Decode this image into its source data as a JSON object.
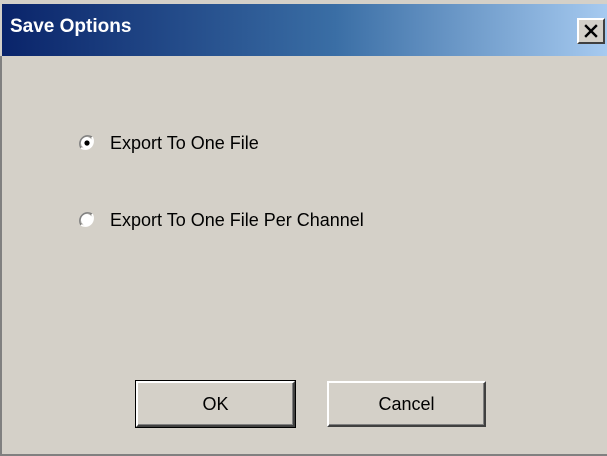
{
  "window": {
    "title": "Save Options",
    "close_icon": "close-icon"
  },
  "options": [
    {
      "label": "Export To One File",
      "selected": true
    },
    {
      "label": "Export To One File Per Channel",
      "selected": false
    }
  ],
  "buttons": {
    "ok_label": "OK",
    "cancel_label": "Cancel"
  },
  "colors": {
    "title_gradient_start": "#0a246a",
    "title_gradient_end": "#a6caf0",
    "dialog_face": "#d4d0c8"
  }
}
